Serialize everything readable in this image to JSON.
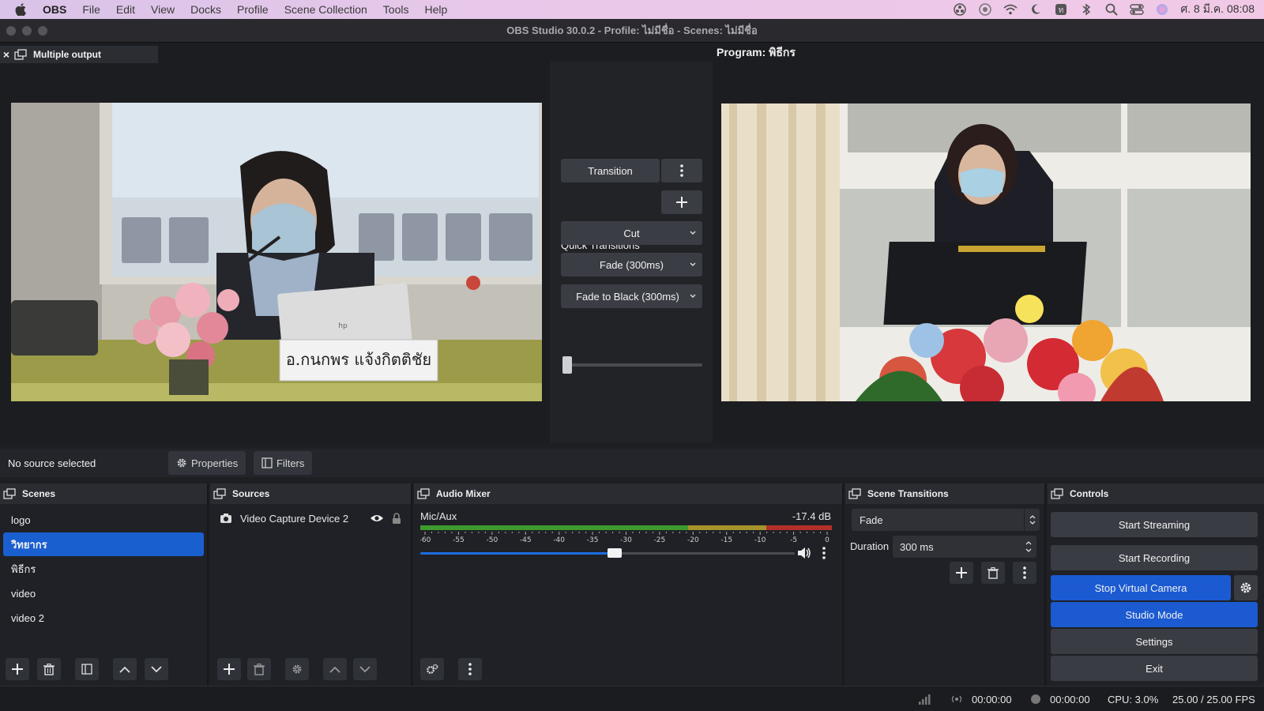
{
  "menubar": {
    "app_name": "OBS",
    "items": [
      "File",
      "Edit",
      "View",
      "Docks",
      "Profile",
      "Scene Collection",
      "Tools",
      "Help"
    ],
    "clock": "ศ. 8 มี.ค. 08:08"
  },
  "window": {
    "title": "OBS Studio 30.0.2 - Profile: ไม่มีชื่อ - Scenes: ไม่มีชื่อ"
  },
  "preview": {
    "multi_output_tab": "Multiple output",
    "close_glyph": "×",
    "program_label": "Program: พิธีกร",
    "left_screen_nameplate": "อ.กนกพร แจ้งกิตติชัย",
    "logo_text": "hp"
  },
  "transitions_panel": {
    "transition_button": "Transition",
    "quick_transitions_label": "Quick Transitions",
    "quick": [
      "Cut",
      "Fade (300ms)",
      "Fade to Black (300ms)"
    ],
    "tbar_value": 0
  },
  "context_bar": {
    "no_source": "No source selected",
    "properties": "Properties",
    "filters": "Filters"
  },
  "scenes": {
    "title": "Scenes",
    "items": [
      "logo",
      "วิทยากร",
      "พิธีกร",
      "video",
      "video 2"
    ],
    "selected": "วิทยากร"
  },
  "sources": {
    "title": "Sources",
    "items": [
      "Video Capture Device 2"
    ]
  },
  "audio_mixer": {
    "title": "Audio Mixer",
    "channel": "Mic/Aux",
    "level": "-17.4 dB",
    "scale": [
      "-60",
      "-55",
      "-50",
      "-45",
      "-40",
      "-35",
      "-30",
      "-25",
      "-20",
      "-15",
      "-10",
      "-5",
      "0"
    ],
    "volume_fraction": 0.52
  },
  "scene_transitions": {
    "title": "Scene Transitions",
    "selected": "Fade",
    "duration_label": "Duration",
    "duration_value": "300 ms"
  },
  "controls": {
    "title": "Controls",
    "start_streaming": "Start Streaming",
    "start_recording": "Start Recording",
    "stop_virtual_camera": "Stop Virtual Camera",
    "studio_mode": "Studio Mode",
    "settings": "Settings",
    "exit": "Exit"
  },
  "statusbar": {
    "stream_time": "00:00:00",
    "record_time": "00:00:00",
    "cpu": "CPU: 3.0%",
    "fps": "25.00 / 25.00 FPS"
  },
  "colors": {
    "accent_blue": "#1b5ad1",
    "panel": "#1f2126",
    "meter_green": "#3e9a2e",
    "meter_yellow": "#b39a2a",
    "meter_red": "#b3302a"
  }
}
